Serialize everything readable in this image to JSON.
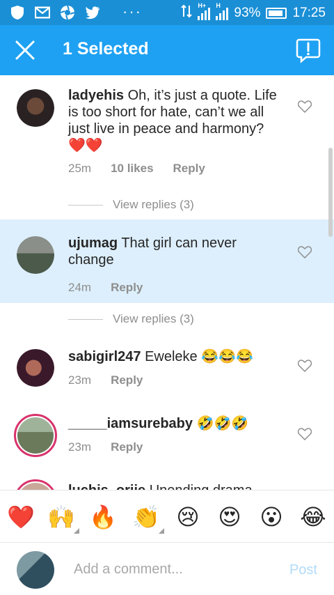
{
  "status_bar": {
    "icons": [
      "shield-icon",
      "gmail-icon",
      "aperture-icon",
      "twitter-icon",
      "more-dots-icon",
      "data-arrows-icon",
      "signal-icon",
      "signal-icon",
      "battery-icon"
    ],
    "dots": "···",
    "network1": "H+",
    "network2": "H",
    "battery": "93%",
    "time": "17:25"
  },
  "app_bar": {
    "title": "1 Selected",
    "close_icon": "close-icon",
    "report_icon": "report-icon",
    "color": "#1ea1f2"
  },
  "comments": [
    {
      "username": "ladyehis",
      "text": "Oh, it’s just a quote. Life is too short for hate, can’t we all just live in peace and harmony?",
      "emoji": "❤️❤️",
      "time": "25m",
      "likes": "10 likes",
      "reply": "Reply",
      "view_replies": "View replies (3)",
      "selected": false
    },
    {
      "username": "ujumag",
      "text": "That girl can never change",
      "time": "24m",
      "reply": "Reply",
      "view_replies": "View replies (3)",
      "selected": true
    },
    {
      "username": "sabigirl247",
      "text": "Eweleke 😂😂😂",
      "time": "23m",
      "reply": "Reply",
      "selected": false
    },
    {
      "username": "_____iamsurebaby",
      "text": "🤣🤣🤣",
      "time": "23m",
      "reply": "Reply",
      "selected": false
    },
    {
      "username": "luchis_orjie",
      "text": "Unending drama",
      "selected": false
    }
  ],
  "emoji_bar": [
    "❤️",
    "🙌",
    "🔥",
    "👏",
    "😢",
    "😍",
    "😮",
    "😂"
  ],
  "input": {
    "placeholder": "Add a comment...",
    "post_label": "Post"
  },
  "colors": {
    "accent": "#1ea1f2",
    "selected_bg": "#ddeffc",
    "post_disabled": "#b3dbf9"
  }
}
